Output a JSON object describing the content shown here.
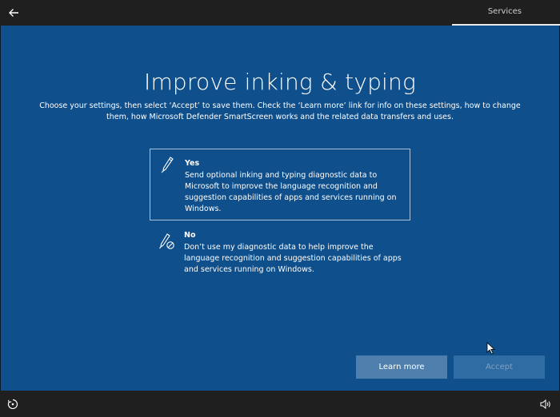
{
  "topbar": {
    "back_icon": "back-arrow-icon",
    "step_label": "Services"
  },
  "page": {
    "title": "Improve inking & typing",
    "subtitle": "Choose your settings, then select ‘Accept’ to save them. Check the ‘Learn more’ link for info on these settings, how to change them, how Microsoft Defender SmartScreen works and the related data transfers and uses."
  },
  "options": [
    {
      "icon": "pen-icon",
      "title": "Yes",
      "description": "Send optional inking and typing diagnostic data to Microsoft to improve the language recognition and suggestion capabilities of apps and services running on Windows.",
      "selected": true
    },
    {
      "icon": "pen-blocked-icon",
      "title": "No",
      "description": "Don’t use my diagnostic data to help improve the language recognition and suggestion capabilities of apps and services running on Windows.",
      "selected": false
    }
  ],
  "buttons": {
    "learn_more": "Learn more",
    "accept": "Accept",
    "accept_enabled": false
  },
  "bottombar": {
    "left_icon": "ease-of-access-icon",
    "right_icon": "volume-icon"
  },
  "colors": {
    "main_bg": "#0f4f8b",
    "bar_bg": "#1f1f1f",
    "learn_more_bg": "#4f80ad",
    "accept_bg_disabled": "#2f6ca4",
    "selected_border": "#a9c3dd"
  }
}
